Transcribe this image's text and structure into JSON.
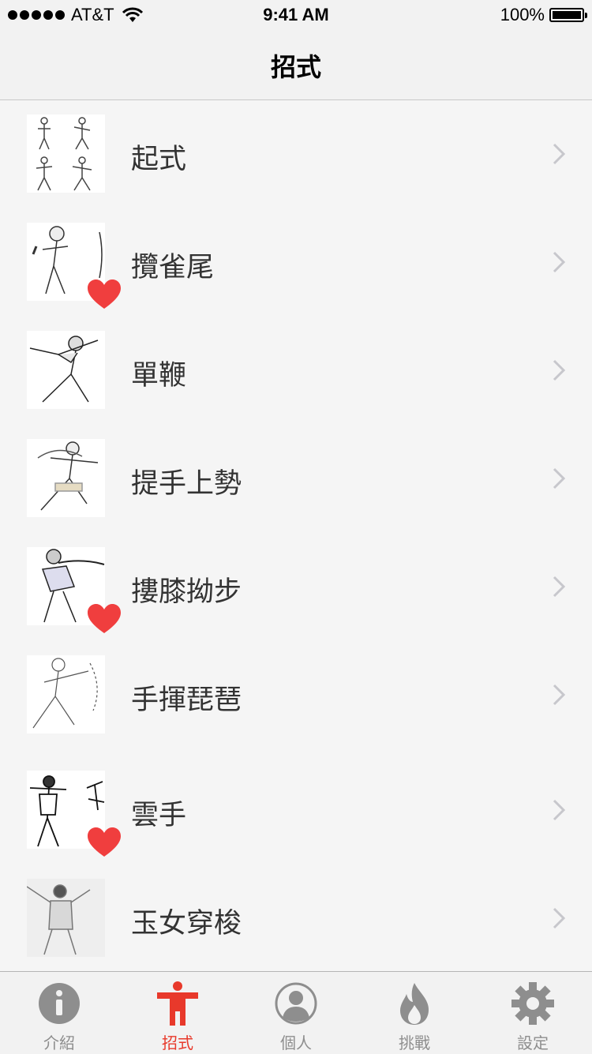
{
  "status_bar": {
    "carrier": "AT&T",
    "time": "9:41 AM",
    "battery": "100%"
  },
  "nav": {
    "title": "招式"
  },
  "rows": [
    {
      "label": "起式",
      "favorite": false
    },
    {
      "label": "攬雀尾",
      "favorite": true
    },
    {
      "label": "單鞭",
      "favorite": false
    },
    {
      "label": "提手上勢",
      "favorite": false
    },
    {
      "label": "摟膝拗步",
      "favorite": true
    },
    {
      "label": "手揮琵琶",
      "favorite": false
    },
    {
      "label": "雲手",
      "favorite": true
    },
    {
      "label": "玉女穿梭",
      "favorite": false
    }
  ],
  "tabs": [
    {
      "label": "介紹",
      "icon": "info-icon",
      "active": false
    },
    {
      "label": "招式",
      "icon": "person-icon",
      "active": true
    },
    {
      "label": "個人",
      "icon": "profile-icon",
      "active": false
    },
    {
      "label": "挑戰",
      "icon": "flame-icon",
      "active": false
    },
    {
      "label": "設定",
      "icon": "gear-icon",
      "active": false
    }
  ],
  "colors": {
    "accent": "#e8392b",
    "heart": "#f03e3e",
    "inactive": "#8e8e8e"
  }
}
